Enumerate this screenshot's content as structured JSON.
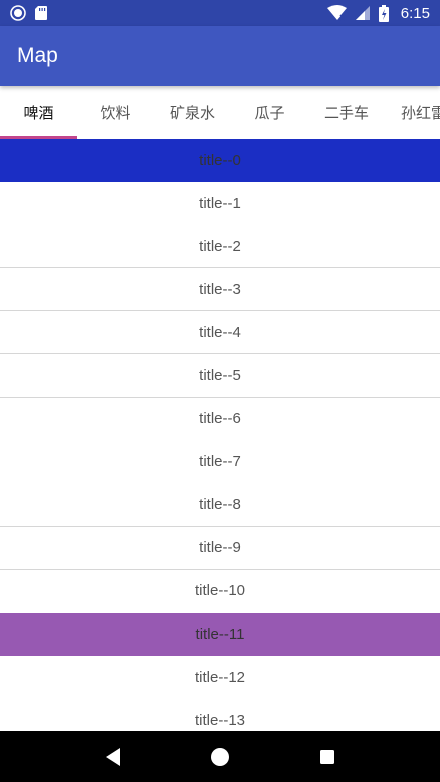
{
  "status_bar": {
    "time": "6:15",
    "icons": [
      "record-icon",
      "sd-card-icon",
      "wifi-icon",
      "signal-icon",
      "battery-icon"
    ]
  },
  "app_bar": {
    "title": "Map"
  },
  "tabs": [
    {
      "label": "啤酒",
      "active": true
    },
    {
      "label": "饮料",
      "active": false
    },
    {
      "label": "矿泉水",
      "active": false
    },
    {
      "label": "瓜子",
      "active": false
    },
    {
      "label": "二手车",
      "active": false
    },
    {
      "label": "孙红雷",
      "active": false
    }
  ],
  "list": {
    "items": [
      {
        "label": "title--0",
        "highlight": "blue"
      },
      {
        "label": "title--1"
      },
      {
        "label": "title--2"
      },
      {
        "label": "title--3"
      },
      {
        "label": "title--4"
      },
      {
        "label": "title--5"
      },
      {
        "label": "title--6"
      },
      {
        "label": "title--7"
      },
      {
        "label": "title--8"
      },
      {
        "label": "title--9"
      },
      {
        "label": "title--10"
      },
      {
        "label": "title--11",
        "highlight": "purple"
      },
      {
        "label": "title--12"
      },
      {
        "label": "title--13"
      }
    ]
  },
  "nav_bar": {
    "buttons": [
      "back-icon",
      "home-icon",
      "recents-icon"
    ]
  },
  "colors": {
    "status_bar": "#2f45a8",
    "app_bar": "#3f57c0",
    "tab_indicator": "#c2458c",
    "highlight_blue": "#1b2ec4",
    "highlight_purple": "#9759b2"
  }
}
